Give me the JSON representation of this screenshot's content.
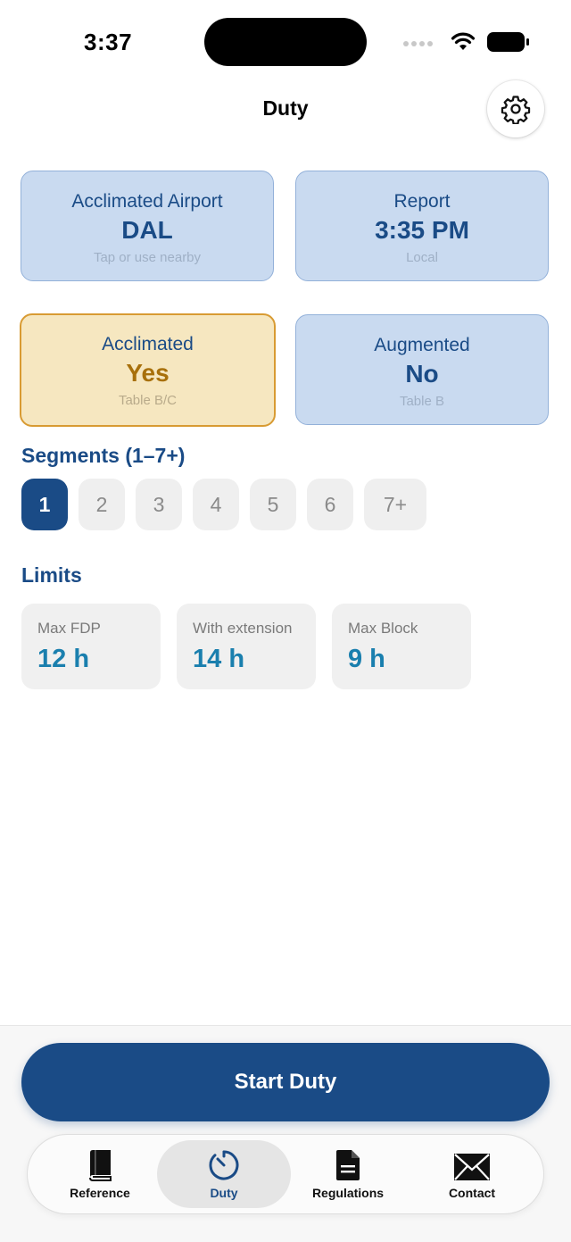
{
  "status_bar": {
    "time": "3:37"
  },
  "nav": {
    "title": "Duty"
  },
  "cards": {
    "acclimated_airport": {
      "label": "Acclimated Airport",
      "value": "DAL",
      "hint": "Tap or use nearby"
    },
    "report": {
      "label": "Report",
      "value": "3:35 PM",
      "hint": "Local"
    },
    "acclimated": {
      "label": "Acclimated",
      "value": "Yes",
      "hint": "Table B/C"
    },
    "augmented": {
      "label": "Augmented",
      "value": "No",
      "hint": "Table B"
    }
  },
  "segments": {
    "title": "Segments (1–7+)",
    "options": [
      "1",
      "2",
      "3",
      "4",
      "5",
      "6",
      "7+"
    ],
    "selected": "1"
  },
  "limits": {
    "title": "Limits",
    "items": [
      {
        "label": "Max FDP",
        "value": "12 h"
      },
      {
        "label": "With extension",
        "value": "14 h"
      },
      {
        "label": "Max Block",
        "value": "9 h"
      }
    ]
  },
  "start_button": {
    "label": "Start Duty"
  },
  "tab_bar": {
    "tabs": [
      {
        "label": "Reference",
        "icon": "book-icon"
      },
      {
        "label": "Duty",
        "icon": "timer-icon"
      },
      {
        "label": "Regulations",
        "icon": "document-icon"
      },
      {
        "label": "Contact",
        "icon": "envelope-icon"
      }
    ],
    "active": "Duty"
  },
  "colors": {
    "primary": "#1a4b86",
    "card_blue": "#c9daf0",
    "card_yellow": "#f6e7c0",
    "accent_yellow": "#d89b33",
    "limit_value": "#1a7fae"
  }
}
